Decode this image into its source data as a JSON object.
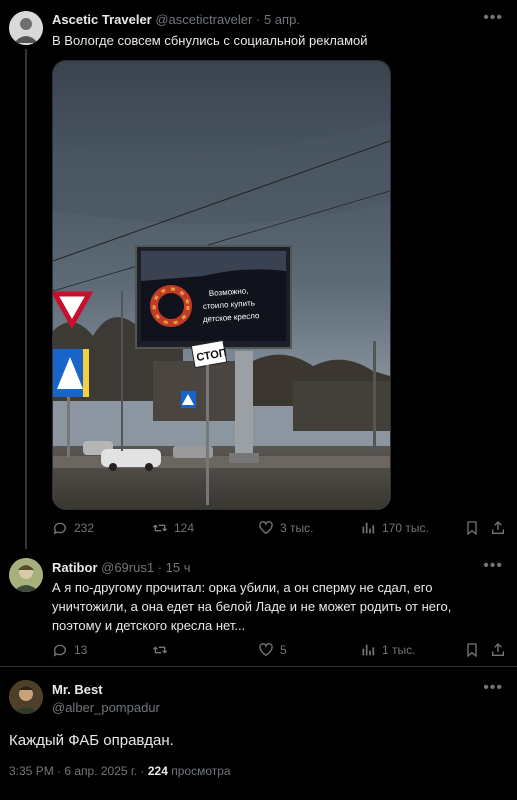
{
  "post1": {
    "display_name": "Ascetic Traveler",
    "handle": "@ascetictraveler",
    "time": "5 апр.",
    "text": "В Вологде совсем сбнулись с социальной рекламой",
    "billboard_text": "Возможно, стоило купить детское кресло",
    "road_sign_text": "СТОП",
    "stats": {
      "replies": "232",
      "reposts": "124",
      "likes": "3 тыс.",
      "views": "170 тыс."
    }
  },
  "post2": {
    "display_name": "Ratibor",
    "handle": "@69rus1",
    "time": "15 ч",
    "text": "А я по-другому прочитал: орка убили, а он сперму не сдал, его уничтожили, а она едет на белой Ладе и не может родить от него, поэтому и детского кресла нет...",
    "stats": {
      "replies": "13",
      "reposts": "",
      "likes": "5",
      "views": "1 тыс."
    }
  },
  "post3": {
    "display_name": "Mr. Best",
    "handle": "@alber_pompadur",
    "text": "Каждый ФАБ оправдан.",
    "timestamp": "3:35 PM · 6 апр. 2025 г.",
    "view_count": "224",
    "views_label": "просмотра"
  },
  "icons": [
    "more-icon",
    "reply-icon",
    "repost-icon",
    "like-icon",
    "views-icon",
    "bookmark-icon",
    "share-icon"
  ],
  "colors": {
    "background": "#000000",
    "text": "#e7e9ea",
    "muted": "#71767b",
    "divider": "#2f3336"
  }
}
